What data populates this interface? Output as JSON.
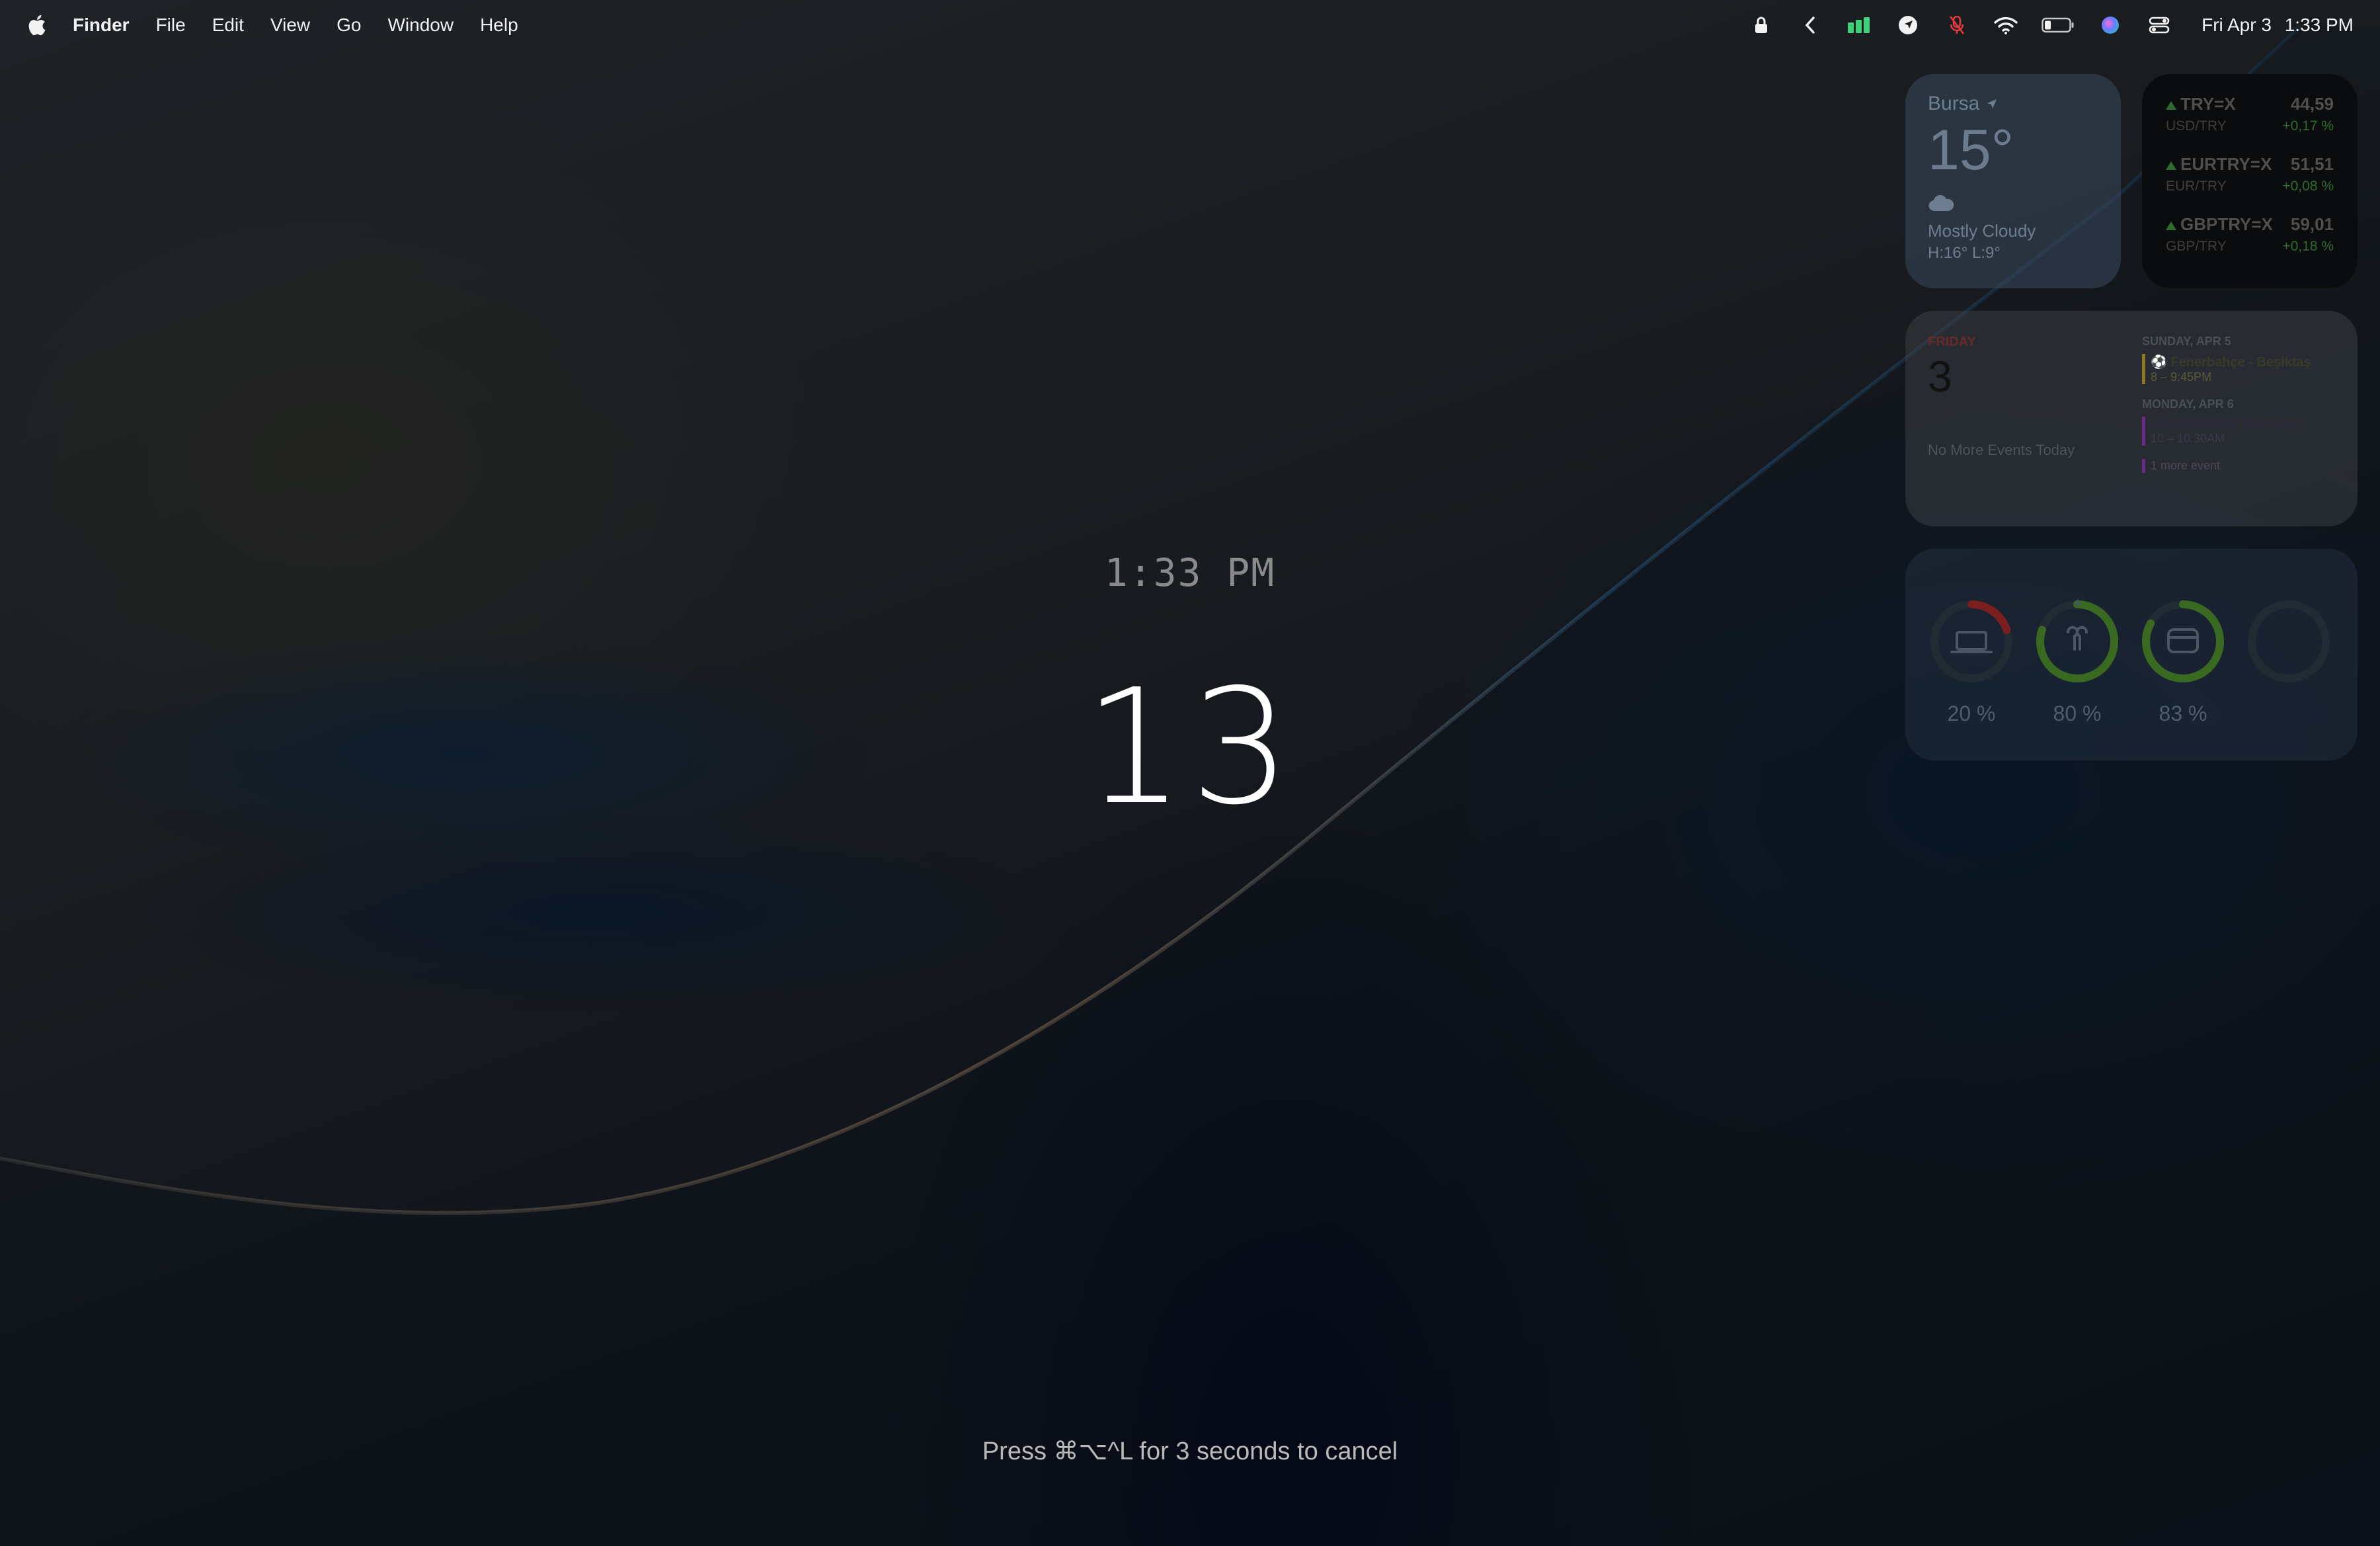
{
  "menubar": {
    "app_name": "Finder",
    "menus": [
      "File",
      "Edit",
      "View",
      "Go",
      "Window",
      "Help"
    ],
    "status_icons": [
      "lock-icon",
      "chevron-left-icon",
      "signal-bars-icon",
      "navigation-icon",
      "mic-muted-icon",
      "wifi-icon",
      "battery-icon",
      "siri-icon",
      "control-center-icon"
    ],
    "date": "Fri Apr 3",
    "time": "1:33 PM"
  },
  "screensaver": {
    "current_time": "1:33 PM",
    "countdown": "13",
    "cancel_hint": "Press ⌘⌥^L for 3 seconds to cancel"
  },
  "weather": {
    "city": "Bursa",
    "temperature": "15°",
    "condition": "Mostly Cloudy",
    "high_low": "H:16° L:9°"
  },
  "stocks": [
    {
      "symbol": "TRY=X",
      "price": "44,59",
      "name": "USD/TRY",
      "change": "+0,17 %"
    },
    {
      "symbol": "EURTRY=X",
      "price": "51,51",
      "name": "EUR/TRY",
      "change": "+0,08 %"
    },
    {
      "symbol": "GBPTRY=X",
      "price": "59,01",
      "name": "GBP/TRY",
      "change": "+0,18 %"
    }
  ],
  "calendar": {
    "weekday": "FRIDAY",
    "day": "3",
    "no_events": "No More Events Today",
    "groups": [
      {
        "heading": "SUNDAY, APR 5",
        "events": [
          {
            "title": "⚽ Fenerbahçe - Beşiktaş",
            "time": "8 – 9:45PM"
          }
        ]
      },
      {
        "heading": "MONDAY, APR 6",
        "events": [
          {
            "title": "Orispi Weekly Planning",
            "time": "10 – 10:30AM"
          }
        ]
      }
    ],
    "more": "1 more event"
  },
  "batteries": [
    {
      "device": "laptop-icon",
      "percent": "20 %",
      "level": 0.2,
      "color": "#7a1e1e"
    },
    {
      "device": "airpods-icon",
      "percent": "80 %",
      "level": 0.8,
      "color": "#3a6a22"
    },
    {
      "device": "case-icon",
      "percent": "83 %",
      "level": 0.83,
      "color": "#3a6a22"
    },
    {
      "device": "empty-slot",
      "percent": "",
      "level": 0,
      "color": "#2a3442"
    }
  ]
}
